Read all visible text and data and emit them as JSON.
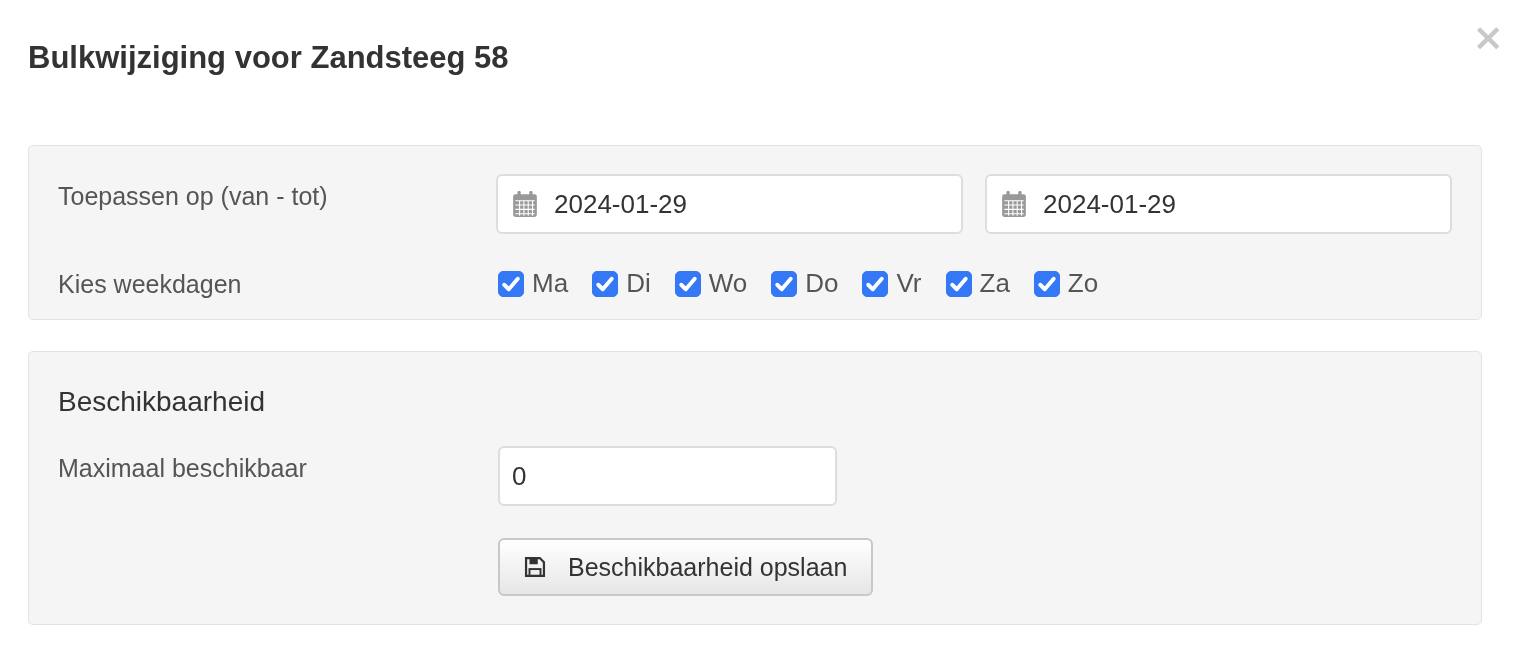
{
  "dialog": {
    "title": "Bulkwijziging voor Zandsteeg 58",
    "close": "×"
  },
  "range": {
    "label": "Toepassen op (van - tot)",
    "from": "2024-01-29",
    "to": "2024-01-29"
  },
  "weekdays": {
    "label": "Kies weekdagen",
    "days": [
      {
        "label": "Ma",
        "checked": true
      },
      {
        "label": "Di",
        "checked": true
      },
      {
        "label": "Wo",
        "checked": true
      },
      {
        "label": "Do",
        "checked": true
      },
      {
        "label": "Vr",
        "checked": true
      },
      {
        "label": "Za",
        "checked": true
      },
      {
        "label": "Zo",
        "checked": true
      }
    ]
  },
  "availability": {
    "heading": "Beschikbaarheid",
    "label": "Maximaal beschikbaar",
    "value": "0",
    "save_button": "Beschikbaarheid opslaan"
  }
}
